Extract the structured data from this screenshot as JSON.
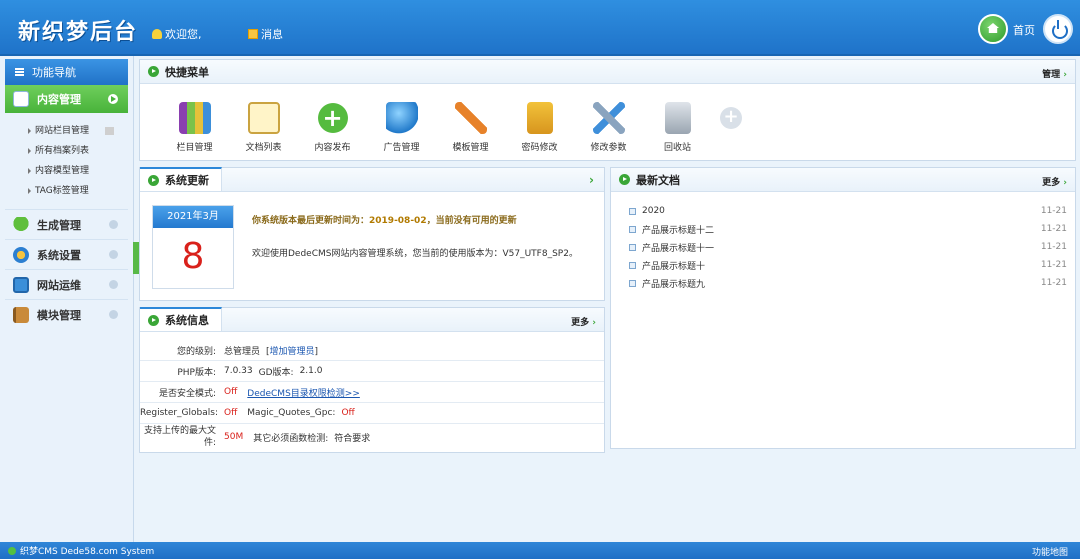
{
  "header": {
    "logo": "新织梦后台",
    "welcome_label": "欢迎您,",
    "messages_label": "消息",
    "home_label": "首页"
  },
  "sidebar": {
    "title": "功能导航",
    "active_item": "内容管理",
    "sub_items": [
      "网站栏目管理",
      "所有档案列表",
      "内容模型管理",
      "TAG标签管理"
    ],
    "items": [
      "生成管理",
      "系统设置",
      "网站运维",
      "模块管理"
    ]
  },
  "quick_menu": {
    "title": "快捷菜单",
    "manage_label": "管理",
    "items": [
      {
        "label": "栏目管理",
        "icon": "columns-icon"
      },
      {
        "label": "文档列表",
        "icon": "document-list-icon"
      },
      {
        "label": "内容发布",
        "icon": "add-content-icon"
      },
      {
        "label": "广告管理",
        "icon": "globe-icon"
      },
      {
        "label": "模板管理",
        "icon": "template-tools-icon"
      },
      {
        "label": "密码修改",
        "icon": "lock-icon"
      },
      {
        "label": "修改参数",
        "icon": "wrench-icon"
      },
      {
        "label": "回收站",
        "icon": "trash-icon"
      }
    ]
  },
  "system_update": {
    "title": "系统更新",
    "calendar_month": "2021年3月",
    "calendar_day": "8",
    "notice_prefix": "你系统版本最后更新时间为：",
    "notice_date": "2019-08-02",
    "notice_suffix": "，当前没有可用的更新",
    "welcome_text": "欢迎使用DedeCMS网站内容管理系统，您当前的使用版本为：V57_UTF8_SP2。"
  },
  "latest_docs": {
    "title": "最新文档",
    "more_label": "更多",
    "items": [
      {
        "title": "2020",
        "date": "11-21"
      },
      {
        "title": "产品展示标题十二",
        "date": "11-21"
      },
      {
        "title": "产品展示标题十一",
        "date": "11-21"
      },
      {
        "title": "产品展示标题十",
        "date": "11-21"
      },
      {
        "title": "产品展示标题九",
        "date": "11-21"
      }
    ]
  },
  "system_info": {
    "title": "系统信息",
    "more_label": "更多",
    "level_label": "您的级别:",
    "level_value": "总管理员",
    "add_admin_link": "增加管理员",
    "php_label": "PHP版本:",
    "php_value": "7.0.33",
    "gd_label": "GD版本:",
    "gd_value": "2.1.0",
    "safe_mode_label": "是否安全模式:",
    "safe_mode_value": "Off",
    "permission_link": "DedeCMS目录权限检测>>",
    "register_globals_label": "Register_Globals:",
    "register_globals_value": "Off",
    "magic_quotes_label": "Magic_Quotes_Gpc:",
    "magic_quotes_value": "Off",
    "upload_label": "支持上传的最大文件:",
    "upload_value": "50M",
    "check_label": "其它必须函数检测:",
    "check_value": "符合要求"
  },
  "footer": {
    "left_text": "织梦CMS Dede58.com System",
    "right_text": "功能地图"
  },
  "colors": {
    "header_blue": "#1f73c9",
    "active_green": "#48b33a",
    "alert_red": "#d9211b"
  }
}
